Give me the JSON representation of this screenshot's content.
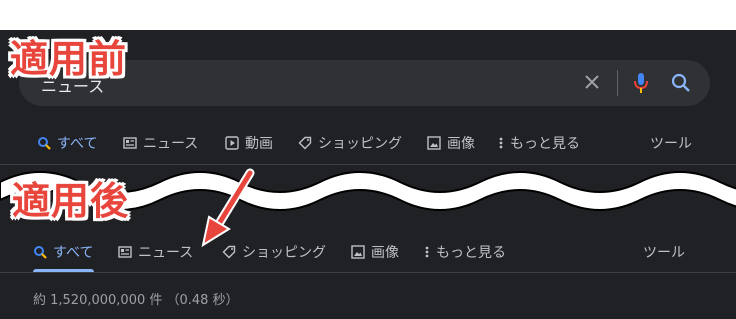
{
  "annotations": {
    "before": "適用前",
    "after": "適用後"
  },
  "search": {
    "query": "ニュース"
  },
  "icons": {
    "clear": "close-icon",
    "mic": "microphone-icon",
    "search": "search-icon",
    "all": "search-icon",
    "news": "news-icon",
    "videos": "play-icon",
    "shopping": "tag-icon",
    "images": "image-icon",
    "more": "more-vertical-icon"
  },
  "tabs_before": {
    "all": "すべて",
    "news": "ニュース",
    "videos": "動画",
    "shopping": "ショッピング",
    "images": "画像",
    "more": "もっと見る",
    "tools": "ツール"
  },
  "tabs_after": {
    "all": "すべて",
    "news": "ニュース",
    "shopping": "ショッピング",
    "images": "画像",
    "more": "もっと見る",
    "tools": "ツール"
  },
  "stats_partial": "(0.48",
  "result_stats": "約 1,520,000,000 件 （0.48 秒）",
  "colors": {
    "accent": "#8ab4f8",
    "annotation": "#e8453c",
    "background": "#202124"
  }
}
